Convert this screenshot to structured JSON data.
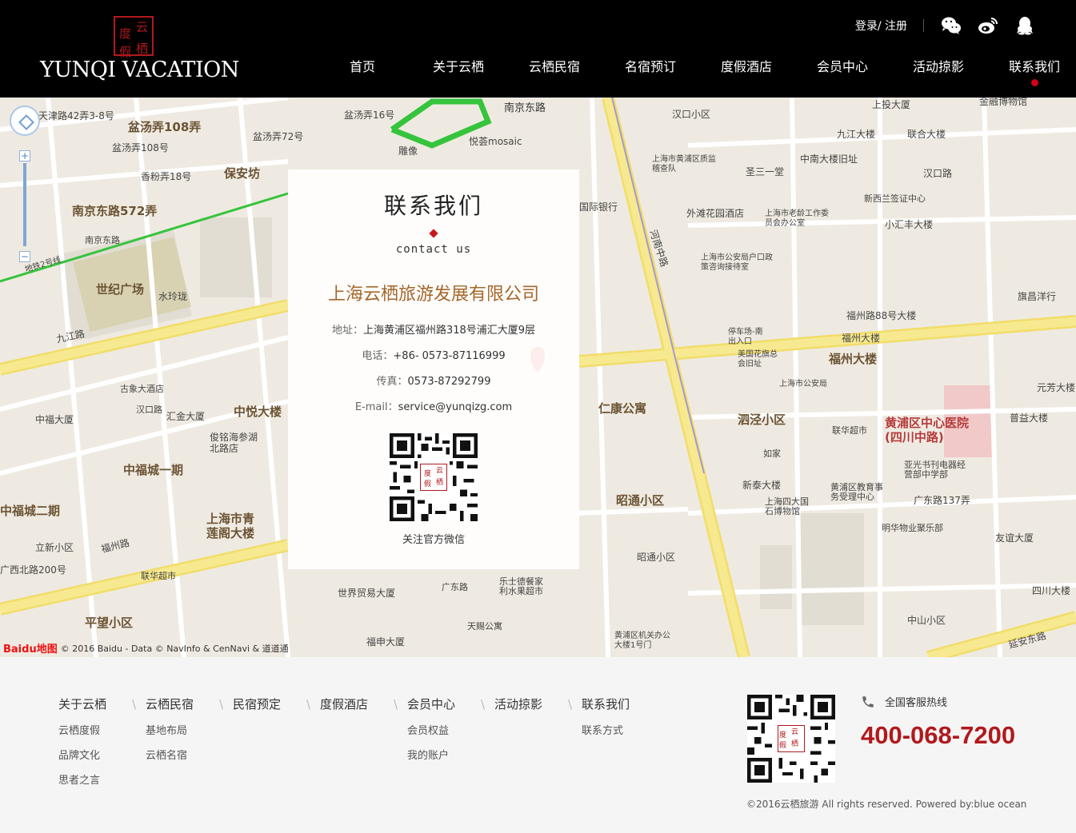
{
  "header": {
    "logo_seal": [
      "云",
      "栖",
      "度",
      "假"
    ],
    "brand": "YUNQI VACATION",
    "login_label": "登录",
    "register_label": "注册",
    "login_separator": "/",
    "icons": [
      "wechat-icon",
      "weibo-icon",
      "qq-icon"
    ]
  },
  "nav": [
    {
      "label": "首页"
    },
    {
      "label": "关于云栖"
    },
    {
      "label": "云栖民宿"
    },
    {
      "label": "名宿预订"
    },
    {
      "label": "度假酒店"
    },
    {
      "label": "会员中心"
    },
    {
      "label": "活动掠影"
    },
    {
      "label": "联系我们",
      "active": true
    }
  ],
  "map": {
    "labels": [
      "天津路42弄3-8号",
      "盆汤弄108弄",
      "盆汤弄16号",
      "盆汤弄72号",
      "南京东路",
      "雕像",
      "悦荟mosaic",
      "汉口小区",
      "上投大厦",
      "金融博物馆",
      "盆汤弄108号",
      "香粉弄18号",
      "保安坊",
      "南京东路572弄",
      "上海市黄浦区质监稽查队",
      "圣三一堂",
      "中南大楼旧址",
      "九江大楼",
      "联合大楼",
      "汉口路",
      "国际银行",
      "外滩花园酒店",
      "新西兰签证中心",
      "小汇丰大楼",
      "南京东路",
      "世纪广场",
      "水玲珑",
      "上海市老龄工作委员会办公室",
      "上海市公安局户口政策咨询接待室",
      "旗昌洋行",
      "福州路88号大楼",
      "福州大楼",
      "福州大楼",
      "停车场-南出入口",
      "美国花旗总会旧址",
      "上海市公安局",
      "元芳大楼",
      "古象大酒店",
      "汉口路",
      "汇金大厦",
      "中悦大楼",
      "中福大厦",
      "仁康公寓",
      "泗泾小区",
      "黄浦区中心医院(四川中路)",
      "联华超市",
      "普益大楼",
      "俊铭海参湖北路店",
      "中福城一期",
      "如家",
      "亚光书刊电器经营部中学部",
      "新泰大楼",
      "黄浦区教育事务受理中心",
      "广东路137弄",
      "中福城二期",
      "上海市青莲阁大楼",
      "昭通小区",
      "上海四大国石博物馆",
      "明华物业聚乐部",
      "立新小区",
      "联华超市",
      "福州路",
      "昭通小区",
      "友谊大厦",
      "广西北路200号",
      "世界贸易大厦",
      "广东路",
      "乐士德餐家利水果超市",
      "四川大楼",
      "平望小区",
      "福申大厦",
      "天赐公寓",
      "黄浦区机关办公大楼1号门",
      "中山小区",
      "九江路",
      "河南中路",
      "地铁2号线",
      "延安东路"
    ],
    "attribution": "© 2016 Baidu - Data © NavInfo & CenNavi & 道道通",
    "baidu_logo": "Baidu地图"
  },
  "contact": {
    "title": "联系我们",
    "subtitle": "contact us",
    "company": "上海云栖旅游发展有限公司",
    "address_label": "地址：",
    "address": "上海黄浦区福州路318号浦汇大厦9层",
    "phone_label": "电话：",
    "phone": "+86- 0573-87116999",
    "fax_label": "传真：",
    "fax": "0573-87292799",
    "email_label": "E-mail：",
    "email": "service@yunqizg.com",
    "qr_caption": "关注官方微信",
    "qr_seal": [
      "云",
      "栖",
      "度",
      "假"
    ]
  },
  "footer": {
    "columns": [
      {
        "heading": "关于云栖",
        "links": [
          "云栖度假",
          "品牌文化",
          "思者之言"
        ]
      },
      {
        "heading": "云栖民宿",
        "links": [
          "基地布局",
          "云栖名宿"
        ]
      },
      {
        "heading": "民宿预定",
        "links": []
      },
      {
        "heading": "度假酒店",
        "links": []
      },
      {
        "heading": "会员中心",
        "links": [
          "会员权益",
          "我的账户"
        ]
      },
      {
        "heading": "活动掠影",
        "links": []
      },
      {
        "heading": "联系我们",
        "links": [
          "联系方式"
        ]
      }
    ],
    "separator": "\\",
    "hotline_label": "全国客服热线",
    "hotline": "400-068-7200",
    "copyright": "©2016云栖旅游 All rights reserved. Powered by:blue ocean"
  },
  "colors": {
    "header_bg": "#000000",
    "accent_red": "#b1191d",
    "company_brown": "#a5672a",
    "map_bg": "#efeae1",
    "road_yellow": "#f7e98f",
    "metro_green": "#35c43c"
  }
}
